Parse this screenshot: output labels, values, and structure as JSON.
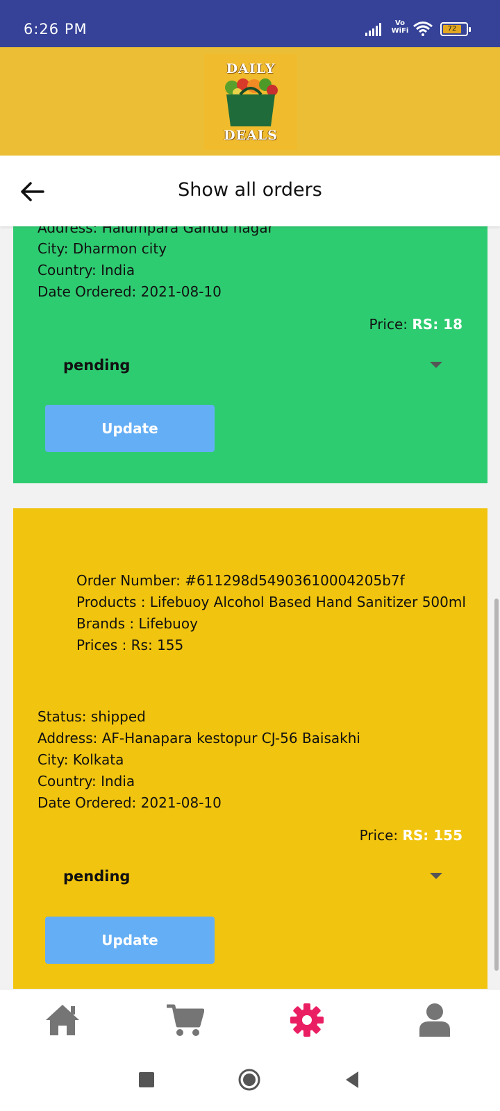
{
  "status_bar": {
    "time": "6:26 PM",
    "network_label_top": "Vo",
    "network_label_bottom": "WiFi",
    "battery_level": "72"
  },
  "brand": {
    "logo_top": "DAILY",
    "logo_bottom": "DEALS"
  },
  "app_bar": {
    "back_icon": "arrow-back-icon",
    "title": "Show all orders"
  },
  "orders": [
    {
      "address": "Address: Halumpara Gandu nagar",
      "city": "City: Dharmon city",
      "country": "Country: India",
      "date": "Date Ordered: 2021-08-10",
      "price_label": "Price: ",
      "price_value": "RS: 18",
      "status_select": "pending",
      "update_label": "Update",
      "color": "#2ecc71"
    },
    {
      "order_number": "Order Number: #611298d54903610004205b7f",
      "products": "Products : Lifebuoy  Alcohol Based Hand Sanitizer 500ml",
      "brands": "Brands : Lifebuoy",
      "prices": "Prices : Rs: 155",
      "status": "Status: shipped",
      "address": "Address: AF-Hanapara kestopur CJ-56 Baisakhi",
      "city": "City: Kolkata",
      "country": "Country: India",
      "date": "Date Ordered: 2021-08-10",
      "price_label": "Price: ",
      "price_value": "RS: 155",
      "status_select": "pending",
      "update_label": "Update",
      "color": "#f1c40f"
    }
  ],
  "bottom_nav": {
    "items": [
      "home-icon",
      "cart-icon",
      "settings-icon",
      "user-icon"
    ],
    "active": "settings-icon",
    "active_color": "#ea1e63",
    "inactive_color": "#757575"
  },
  "system_nav": {
    "items": [
      "recents-square-icon",
      "home-circle-icon",
      "back-triangle-icon"
    ]
  }
}
